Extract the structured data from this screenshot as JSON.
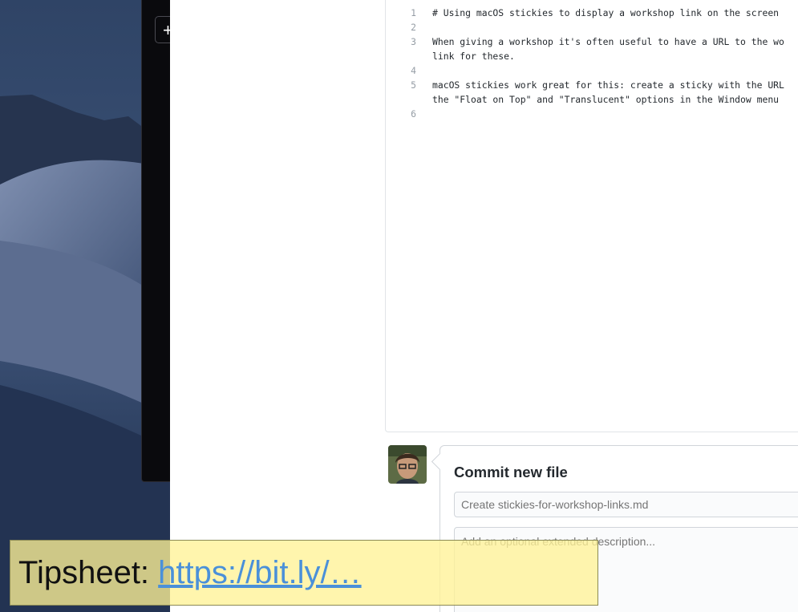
{
  "desktop": {
    "new_tab_symbol": "+"
  },
  "editor": {
    "lines": [
      {
        "number": "1",
        "text": "# Using macOS stickies to display a workshop link on the screen"
      },
      {
        "number": "2",
        "text": ""
      },
      {
        "number": "3",
        "text": "When giving a workshop it's often useful to have a URL to the wo"
      },
      {
        "number": "",
        "text": "link for these."
      },
      {
        "number": "4",
        "text": ""
      },
      {
        "number": "5",
        "text": "macOS stickies work great for this: create a sticky with the URL"
      },
      {
        "number": "",
        "text": "the \"Float on Top\" and \"Translucent\" options in the Window menu"
      },
      {
        "number": "6",
        "text": ""
      }
    ]
  },
  "commit": {
    "title": "Commit new file",
    "summary_placeholder": "Create stickies-for-workshop-links.md",
    "description_placeholder": "Add an optional extended description..."
  },
  "sticky": {
    "label": "Tipsheet: ",
    "link": "https://bit.ly/…"
  }
}
